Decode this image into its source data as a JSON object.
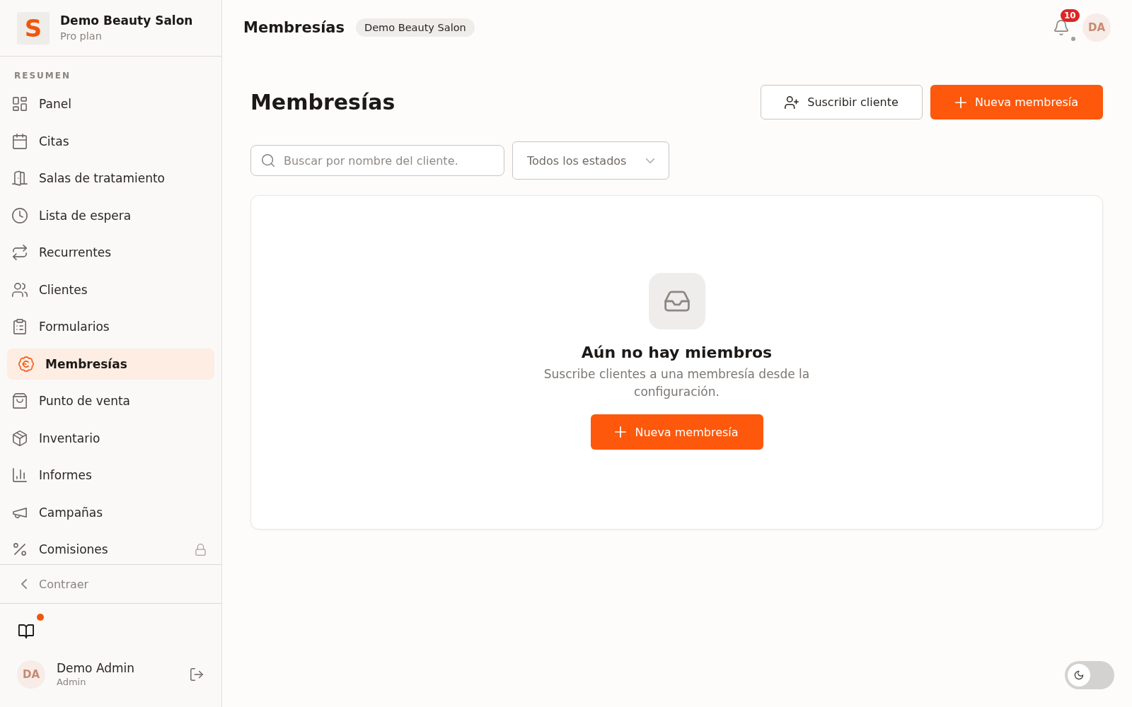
{
  "sidebar": {
    "brand": {
      "logo_letter": "S",
      "name": "Demo Beauty Salon",
      "plan": "Pro plan"
    },
    "section_label": "RESUMEN",
    "items": [
      {
        "label": "Panel",
        "selected": false,
        "locked": false
      },
      {
        "label": "Citas",
        "selected": false,
        "locked": false
      },
      {
        "label": "Salas de tratamiento",
        "selected": false,
        "locked": false
      },
      {
        "label": "Lista de espera",
        "selected": false,
        "locked": false
      },
      {
        "label": "Recurrentes",
        "selected": false,
        "locked": false
      },
      {
        "label": "Clientes",
        "selected": false,
        "locked": false
      },
      {
        "label": "Formularios",
        "selected": false,
        "locked": false
      },
      {
        "label": "Membresías",
        "selected": true,
        "locked": false
      },
      {
        "label": "Punto de venta",
        "selected": false,
        "locked": false
      },
      {
        "label": "Inventario",
        "selected": false,
        "locked": false
      },
      {
        "label": "Informes",
        "selected": false,
        "locked": false
      },
      {
        "label": "Campañas",
        "selected": false,
        "locked": false
      },
      {
        "label": "Comisiones",
        "selected": false,
        "locked": true
      }
    ],
    "collapse_label": "Contraer",
    "docs": {
      "unread": true
    },
    "user": {
      "initials": "DA",
      "name": "Demo Admin",
      "role": "Admin"
    }
  },
  "header": {
    "title": "Membresías",
    "workspace_badge": "Demo Beauty Salon",
    "notification_count": "10",
    "avatar_initials": "DA"
  },
  "page": {
    "title": "Membresías",
    "actions": [
      {
        "kind": "secondary",
        "label": "Suscribir cliente"
      },
      {
        "kind": "primary",
        "label": "Nueva membresía"
      }
    ],
    "search": {
      "placeholder": "Buscar por nombre del cliente."
    },
    "status_filter": {
      "value": "Todos los estados"
    },
    "empty_state": {
      "title": "Aún no hay miembros",
      "description": "Suscribe clientes a una membresía desde la configuración.",
      "button": "Nueva membresía"
    }
  },
  "theme_toggle": {
    "on": false
  }
}
